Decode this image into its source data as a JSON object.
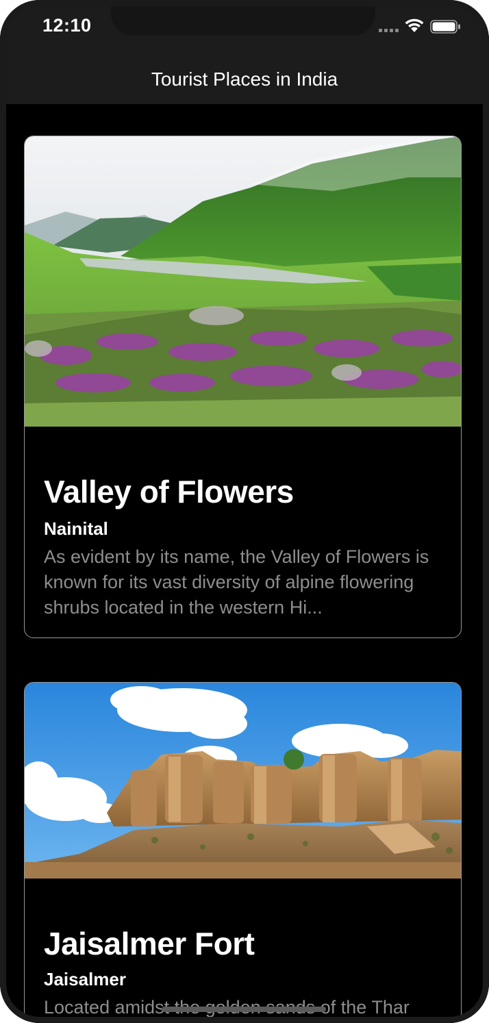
{
  "status_bar": {
    "time": "12:10",
    "icons": [
      "cellular-signal-icon",
      "wifi-icon",
      "battery-icon"
    ]
  },
  "navigation": {
    "title": "Tourist Places in India"
  },
  "places": [
    {
      "title": "Valley of Flowers",
      "location": "Nainital",
      "description": "As evident by its name, the Valley of Flowers is known for its vast diversity of alpine flowering shrubs located in the western Hi..."
    },
    {
      "title": "Jaisalmer Fort",
      "location": "Jaisalmer",
      "description": "Located amidst the golden sands of the Thar"
    }
  ],
  "colors": {
    "background": "#000000",
    "bar_background": "#1c1c1c",
    "card_border": "#9a9a9a",
    "description_text": "#8e8e8e"
  }
}
